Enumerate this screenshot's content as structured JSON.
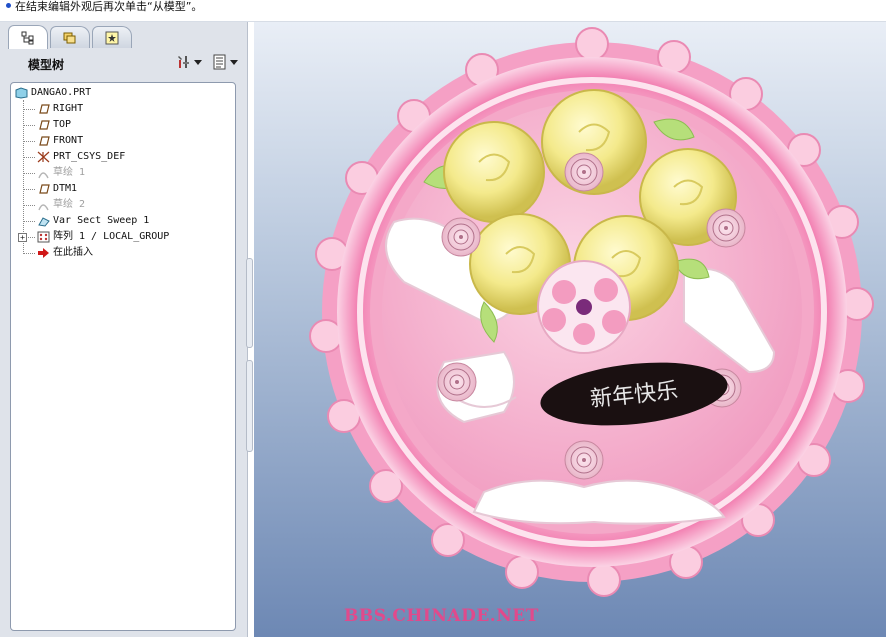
{
  "message_bar": {
    "text": "在结束编辑外观后再次单击“从模型”。"
  },
  "tabs": [
    {
      "name": "model-tree-tab",
      "icon": "model-tree-icon"
    },
    {
      "name": "folder-browser-tab",
      "icon": "folder-icon"
    },
    {
      "name": "favorites-tab",
      "icon": "star-icon"
    }
  ],
  "tree_panel": {
    "title": "模型树",
    "tools": [
      {
        "icon": "settings-tools-icon"
      },
      {
        "icon": "show-list-icon"
      }
    ]
  },
  "tree": {
    "root": "DANGAO.PRT",
    "items": [
      {
        "label": "RIGHT",
        "icon": "datum-plane-icon",
        "state": "normal"
      },
      {
        "label": "TOP",
        "icon": "datum-plane-icon",
        "state": "normal"
      },
      {
        "label": "FRONT",
        "icon": "datum-plane-icon",
        "state": "normal"
      },
      {
        "label": "PRT_CSYS_DEF",
        "icon": "coordinate-system-icon",
        "state": "normal"
      },
      {
        "label": "草绘 1",
        "icon": "sketch-icon",
        "state": "hidden"
      },
      {
        "label": "DTM1",
        "icon": "datum-plane-icon",
        "state": "normal"
      },
      {
        "label": "草绘 2",
        "icon": "sketch-icon",
        "state": "hidden"
      },
      {
        "label": "Var Sect Sweep 1",
        "icon": "sweep-icon",
        "state": "normal"
      },
      {
        "label": "阵列 1 / LOCAL_GROUP",
        "icon": "pattern-icon",
        "state": "normal",
        "expandable": true
      },
      {
        "label": "在此插入",
        "icon": "insert-here-arrow-icon",
        "state": "normal"
      }
    ]
  },
  "viewport": {
    "model_image": "pink-round-cake-with-yellow-roses",
    "plaque_text": "新年快乐",
    "watermark": "BBS.CHINADE.NET"
  },
  "colors": {
    "accent": "#1f4fc9",
    "cake_pink": "#f6a9cb",
    "frosting_pink": "#f9c6dd",
    "rose_yellow": "#f4ea8c",
    "watermark": "#e04a8c"
  }
}
